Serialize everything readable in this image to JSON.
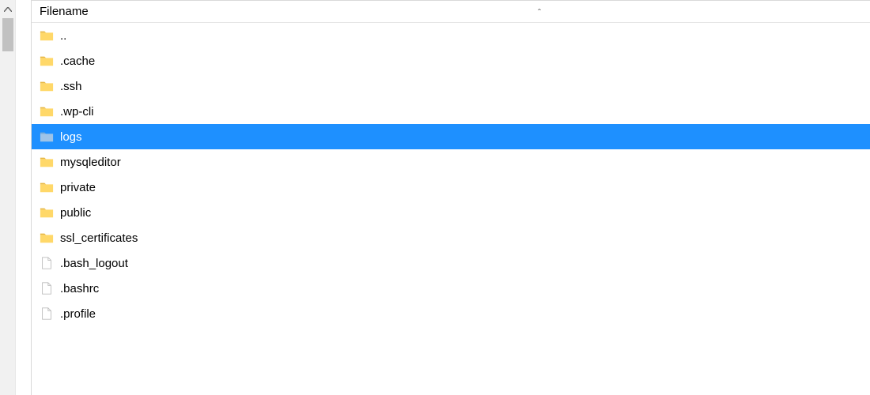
{
  "header": {
    "column_label": "Filename",
    "sort_indicator": "ˆ"
  },
  "items": [
    {
      "name": "..",
      "type": "folder",
      "selected": false
    },
    {
      "name": ".cache",
      "type": "folder",
      "selected": false
    },
    {
      "name": ".ssh",
      "type": "folder",
      "selected": false
    },
    {
      "name": ".wp-cli",
      "type": "folder",
      "selected": false
    },
    {
      "name": "logs",
      "type": "folder",
      "selected": true
    },
    {
      "name": "mysqleditor",
      "type": "folder",
      "selected": false
    },
    {
      "name": "private",
      "type": "folder",
      "selected": false
    },
    {
      "name": "public",
      "type": "folder",
      "selected": false
    },
    {
      "name": "ssl_certificates",
      "type": "folder",
      "selected": false
    },
    {
      "name": ".bash_logout",
      "type": "file",
      "selected": false
    },
    {
      "name": ".bashrc",
      "type": "file",
      "selected": false
    },
    {
      "name": ".profile",
      "type": "file",
      "selected": false
    }
  ]
}
